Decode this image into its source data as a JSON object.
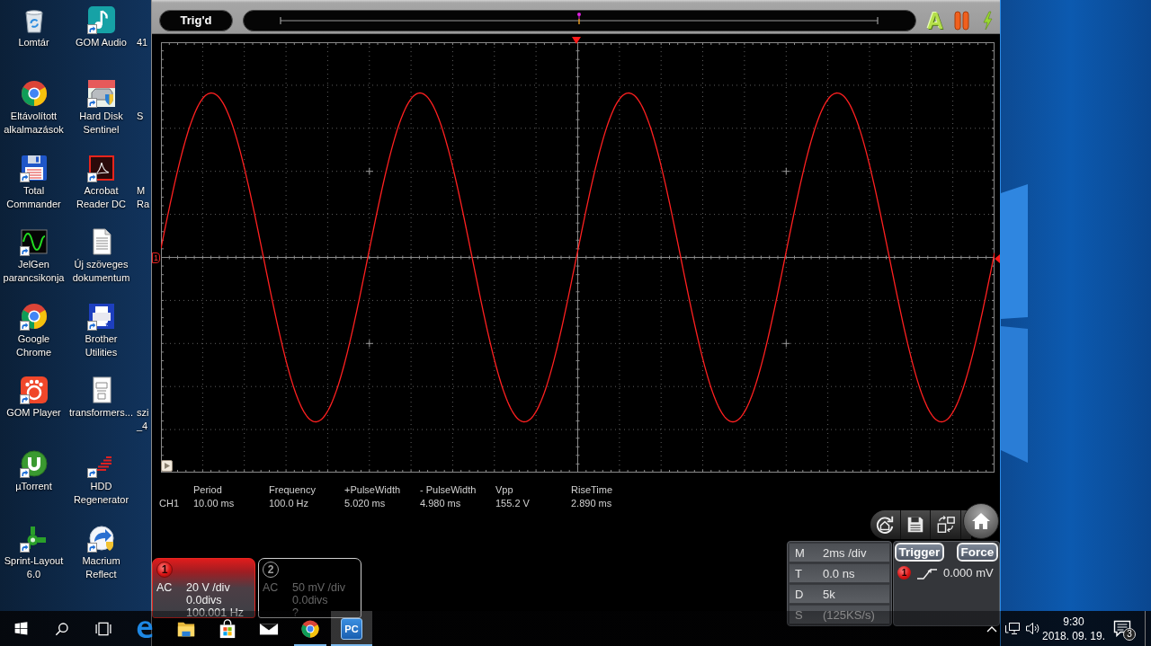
{
  "desktop": {
    "rows": [
      [
        {
          "kind": "recycle",
          "label": "Lomtár",
          "shortcut": false
        },
        {
          "kind": "music",
          "label": "GOM Audio",
          "shortcut": true
        },
        {
          "kind": "covered",
          "label": "41"
        }
      ],
      [
        {
          "kind": "browser",
          "label": "Eltávolított\nalkalmazások",
          "shortcut": false
        },
        {
          "kind": "drive",
          "label": "Hard Disk\nSentinel",
          "shortcut": true
        },
        {
          "kind": "covered",
          "label": "S"
        }
      ],
      [
        {
          "kind": "floppy",
          "label": "Total\nCommander",
          "shortcut": true
        },
        {
          "kind": "pdf",
          "label": "Acrobat\nReader DC",
          "shortcut": true
        },
        {
          "kind": "covered",
          "label": "M\nRa"
        }
      ],
      [
        {
          "kind": "sine",
          "label": "JelGen\nparancsikonja",
          "shortcut": true
        },
        {
          "kind": "text",
          "label": "Új szöveges\ndokumentum",
          "shortcut": false
        }
      ],
      [
        {
          "kind": "browser",
          "label": "Google\nChrome",
          "shortcut": true
        },
        {
          "kind": "printer",
          "label": "Brother\nUtilities",
          "shortcut": true
        }
      ],
      [
        {
          "kind": "player",
          "label": "GOM Player",
          "shortcut": true
        },
        {
          "kind": "scan",
          "label": "transformers...",
          "shortcut": false
        },
        {
          "kind": "covered",
          "label": "szi\n_4"
        }
      ],
      [
        {
          "kind": "torrent",
          "label": "µTorrent",
          "shortcut": true
        },
        {
          "kind": "bars",
          "label": "HDD\nRegenerator",
          "shortcut": true
        }
      ],
      [
        {
          "kind": "layout",
          "label": "Sprint-Layout\n6.0",
          "shortcut": true
        },
        {
          "kind": "backup",
          "label": "Macrium\nReflect",
          "shortcut": true
        }
      ]
    ]
  },
  "window": {
    "status": "Trig'd",
    "auto_label": "A",
    "ground_marker": "1",
    "measurements": {
      "channel": "CH1",
      "items": [
        {
          "name": "Period",
          "value": "10.00 ms"
        },
        {
          "name": "Frequency",
          "value": "100.0 Hz"
        },
        {
          "name": "+PulseWidth",
          "value": "5.020 ms"
        },
        {
          "name": "- PulseWidth",
          "value": "4.980 ms"
        },
        {
          "name": "Vpp",
          "value": "155.2 V"
        },
        {
          "name": "RiseTime",
          "value": "2.890 ms"
        }
      ]
    },
    "channels": [
      {
        "number": "1",
        "coupling": "AC",
        "scale": "20 V /div",
        "offset": "0.0divs",
        "frequency": "100.001 Hz",
        "enabled": true
      },
      {
        "number": "2",
        "coupling": "AC",
        "scale": "50 mV /div",
        "offset": "0.0divs",
        "frequency": "?",
        "enabled": false
      }
    ],
    "timebase": [
      {
        "key": "M",
        "value": "2ms /div"
      },
      {
        "key": "T",
        "value": "0.0 ns"
      },
      {
        "key": "D",
        "value": "5k"
      },
      {
        "key": "S",
        "value": "(125KS/s)"
      }
    ],
    "trigger": {
      "button": "Trigger",
      "force": "Force",
      "source": "1",
      "rising_edge": true,
      "threshold": "0.000 mV"
    }
  },
  "taskbar": {
    "system_buttons": [
      {
        "kind": "start"
      },
      {
        "kind": "search"
      },
      {
        "kind": "taskview"
      }
    ],
    "apps": [
      {
        "kind": "edge",
        "running": false,
        "active": false
      },
      {
        "kind": "folder",
        "running": false,
        "active": false
      },
      {
        "kind": "store",
        "running": false,
        "active": false
      },
      {
        "kind": "mail",
        "running": false,
        "active": false
      },
      {
        "kind": "chrome",
        "running": true,
        "active": false
      },
      {
        "kind": "tile",
        "label": "PC",
        "running": true,
        "active": true
      }
    ],
    "tray": {
      "time": "9:30",
      "date": "2018. 09. 19.",
      "notifications": "3"
    }
  }
}
